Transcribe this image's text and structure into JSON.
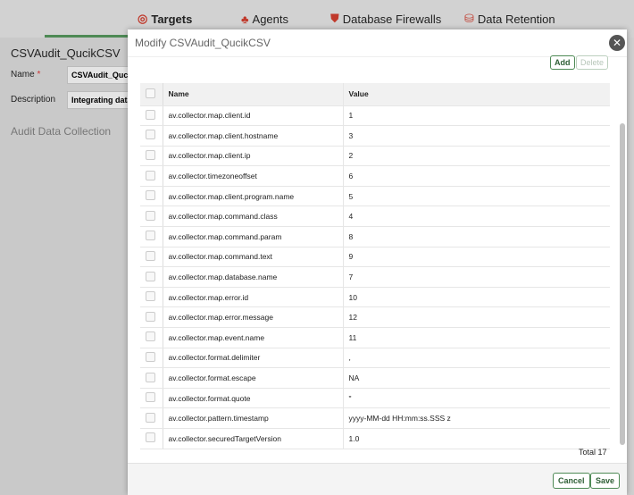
{
  "nav": {
    "tabs": [
      {
        "label": "Targets",
        "icon": "target-icon"
      },
      {
        "label": "Agents",
        "icon": "agents-icon"
      },
      {
        "label": "Database Firewalls",
        "icon": "shield-icon"
      },
      {
        "label": "Data Retention",
        "icon": "database-icon"
      }
    ]
  },
  "left": {
    "title": "CSVAudit_QucikCSV",
    "name_label": "Name",
    "required": "*",
    "name_value": "CSVAudit_QucikCSV",
    "desc_label": "Description",
    "desc_value": "Integrating database",
    "section": "Audit Data Collection"
  },
  "modal": {
    "title": "Modify CSVAudit_QucikCSV",
    "add": "Add",
    "delete": "Delete",
    "columns": [
      "Name",
      "Value"
    ],
    "rows": [
      [
        "av.collector.map.client.id",
        "1"
      ],
      [
        "av.collector.map.client.hostname",
        "3"
      ],
      [
        "av.collector.map.client.ip",
        "2"
      ],
      [
        "av.collector.timezoneoffset",
        "6"
      ],
      [
        "av.collector.map.client.program.name",
        "5"
      ],
      [
        "av.collector.map.command.class",
        "4"
      ],
      [
        "av.collector.map.command.param",
        "8"
      ],
      [
        "av.collector.map.command.text",
        "9"
      ],
      [
        "av.collector.map.database.name",
        "7"
      ],
      [
        "av.collector.map.error.id",
        "10"
      ],
      [
        "av.collector.map.error.message",
        "12"
      ],
      [
        "av.collector.map.event.name",
        "11"
      ],
      [
        "av.collector.format.delimiter",
        ","
      ],
      [
        "av.collector.format.escape",
        "NA"
      ],
      [
        "av.collector.format.quote",
        "\""
      ],
      [
        "av.collector.pattern.timestamp",
        "yyyy-MM-dd HH:mm:ss.SSS z"
      ],
      [
        "av.collector.securedTargetVersion",
        "1.0"
      ]
    ],
    "total": "Total 17",
    "cancel": "Cancel",
    "save": "Save"
  },
  "colors": {
    "accent": "#4e8a55",
    "icon_red": "#c0392b"
  }
}
